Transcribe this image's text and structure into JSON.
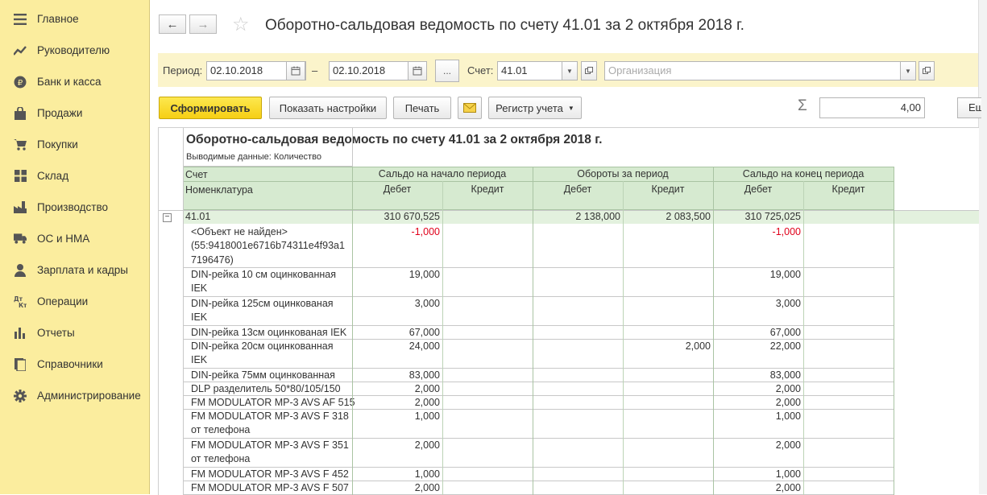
{
  "sidebar": {
    "items": [
      {
        "label": "Главное",
        "icon": "menu-icon"
      },
      {
        "label": "Руководителю",
        "icon": "trend-icon"
      },
      {
        "label": "Банк и касса",
        "icon": "coin-icon"
      },
      {
        "label": "Продажи",
        "icon": "bag-icon"
      },
      {
        "label": "Покупки",
        "icon": "cart-icon"
      },
      {
        "label": "Склад",
        "icon": "grid-icon"
      },
      {
        "label": "Производство",
        "icon": "factory-icon"
      },
      {
        "label": "ОС и НМА",
        "icon": "truck-icon"
      },
      {
        "label": "Зарплата и кадры",
        "icon": "person-icon"
      },
      {
        "label": "Операции",
        "icon": "dt-kt-icon"
      },
      {
        "label": "Отчеты",
        "icon": "bar-chart-icon"
      },
      {
        "label": "Справочники",
        "icon": "book-icon"
      },
      {
        "label": "Администрирование",
        "icon": "gear-icon"
      }
    ]
  },
  "header": {
    "title": "Оборотно-сальдовая ведомость по счету 41.01 за 2 октября 2018 г.",
    "back": "←",
    "forward": "→"
  },
  "filters": {
    "period_label": "Период:",
    "date_from": "02.10.2018",
    "dash": "–",
    "date_to": "02.10.2018",
    "ellipsis": "...",
    "account_label": "Счет:",
    "account": "41.01",
    "organization_placeholder": "Организация"
  },
  "toolbar": {
    "generate": "Сформировать",
    "show_settings": "Показать настройки",
    "print": "Печать",
    "register": "Регистр учета",
    "sum_value": "4,00",
    "more": "Еще"
  },
  "report": {
    "title": "Оборотно-сальдовая ведомость по счету 41.01 за 2 октября 2018 г.",
    "output": "Выводимые данные:  Количество",
    "headers": {
      "account": "Счет",
      "nomenclature": "Номенклатура",
      "start_balance": "Сальдо на начало периода",
      "turnover": "Обороты за период",
      "end_balance": "Сальдо на конец периода",
      "debit": "Дебет",
      "credit": "Кредит"
    },
    "group_row": {
      "account": "41.01",
      "start_debit": "310 670,525",
      "start_credit": "",
      "turn_debit": "2 138,000",
      "turn_credit": "2 083,500",
      "end_debit": "310 725,025",
      "end_credit": ""
    },
    "rows": [
      {
        "name": [
          "<Объект не найден>",
          "(55:9418001e6716b74311e4f93a1",
          "7196476)"
        ],
        "start_debit": "-1,000",
        "turn_debit": "",
        "turn_credit": "",
        "end_debit": "-1,000",
        "negative": true
      },
      {
        "name": [
          "DIN-рейка 10 см оцинкованная",
          "IEK"
        ],
        "start_debit": "19,000",
        "turn_debit": "",
        "turn_credit": "",
        "end_debit": "19,000"
      },
      {
        "name": [
          "DIN-рейка 125см оцинкованая",
          "IEK"
        ],
        "start_debit": "3,000",
        "turn_debit": "",
        "turn_credit": "",
        "end_debit": "3,000"
      },
      {
        "name": [
          "DIN-рейка 13см оцинкованая IEK"
        ],
        "start_debit": "67,000",
        "turn_debit": "",
        "turn_credit": "",
        "end_debit": "67,000"
      },
      {
        "name": [
          "DIN-рейка 20см оцинкованная",
          "IEK"
        ],
        "start_debit": "24,000",
        "turn_debit": "",
        "turn_credit": "2,000",
        "end_debit": "22,000"
      },
      {
        "name": [
          "DIN-рейка 75мм оцинкованная"
        ],
        "start_debit": "83,000",
        "turn_debit": "",
        "turn_credit": "",
        "end_debit": "83,000"
      },
      {
        "name": [
          "DLP разделитель 50*80/105/150"
        ],
        "start_debit": "2,000",
        "turn_debit": "",
        "turn_credit": "",
        "end_debit": "2,000"
      },
      {
        "name": [
          "FM MODULATOR MP-3 AVS AF 515"
        ],
        "start_debit": "2,000",
        "turn_debit": "",
        "turn_credit": "",
        "end_debit": "2,000"
      },
      {
        "name": [
          "FM MODULATOR MP-3 AVS F 318",
          "от телефона"
        ],
        "start_debit": "1,000",
        "turn_debit": "",
        "turn_credit": "",
        "end_debit": "1,000"
      },
      {
        "name": [
          "FM MODULATOR MP-3 AVS F 351",
          "от телефона"
        ],
        "start_debit": "2,000",
        "turn_debit": "",
        "turn_credit": "",
        "end_debit": "2,000"
      },
      {
        "name": [
          "FM MODULATOR MP-3 AVS F 452"
        ],
        "start_debit": "1,000",
        "turn_debit": "",
        "turn_credit": "",
        "end_debit": "1,000"
      },
      {
        "name": [
          "FM MODULATOR MP-3 AVS F 507"
        ],
        "start_debit": "2,000",
        "turn_debit": "",
        "turn_credit": "",
        "end_debit": "2,000"
      }
    ]
  }
}
